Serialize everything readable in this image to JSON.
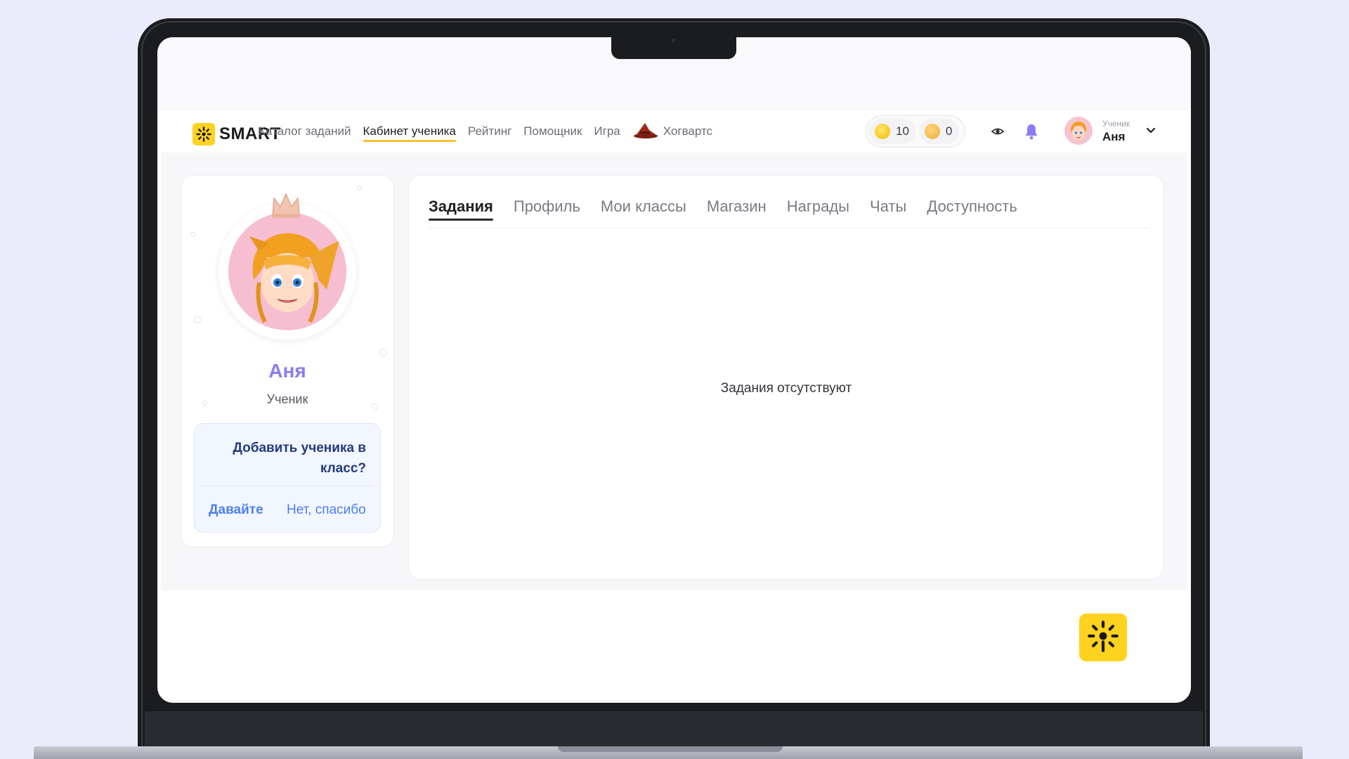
{
  "brand": {
    "name": "SMART"
  },
  "nav": {
    "items": [
      {
        "label": "Каталог заданий"
      },
      {
        "label": "Кабинет ученика"
      },
      {
        "label": "Рейтинг"
      },
      {
        "label": "Помощник"
      },
      {
        "label": "Игра"
      },
      {
        "label": "Хогвартс"
      }
    ],
    "active": "Кабинет ученика"
  },
  "currency": {
    "coins": "10",
    "tokens": "0"
  },
  "user": {
    "role": "Ученик",
    "name": "Аня"
  },
  "profile": {
    "name": "Аня",
    "role": "Ученик",
    "invite": {
      "question": "Добавить ученика в класс?",
      "accept_label": "Давайте",
      "decline_label": "Нет, спасибо"
    }
  },
  "tabs": {
    "items": [
      {
        "label": "Задания"
      },
      {
        "label": "Профиль"
      },
      {
        "label": "Мои классы"
      },
      {
        "label": "Магазин"
      },
      {
        "label": "Награды"
      },
      {
        "label": "Чаты"
      },
      {
        "label": "Доступность"
      }
    ],
    "active": "Задания"
  },
  "tasks": {
    "empty_message": "Задания отсутствуют"
  },
  "colors": {
    "accent_yellow": "#ffd21f",
    "name_purple": "#8a7cf2",
    "link_blue": "#4c7ef0",
    "bell_purple": "#8b7cf6"
  }
}
